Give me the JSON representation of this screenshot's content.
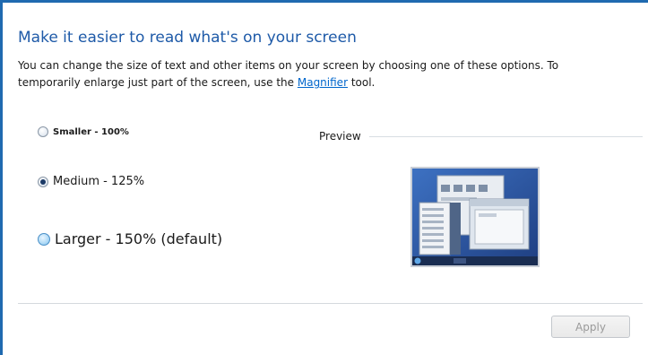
{
  "title": "Make it easier to read what's on your screen",
  "description": {
    "line1": "You can change the size of text and other items on your screen by choosing one of these options. To",
    "line2_prefix": "temporarily enlarge just part of the screen, use the ",
    "link": "Magnifier",
    "line2_suffix": " tool."
  },
  "options": [
    {
      "label": "Smaller - 100%",
      "selected": false
    },
    {
      "label": "Medium - 125%",
      "selected": true
    },
    {
      "label": "Larger - 150% (default)",
      "selected": false
    }
  ],
  "preview": {
    "label": "Preview"
  },
  "apply_label": "Apply",
  "colors": {
    "title": "#1e5aa8",
    "link": "#0066cc",
    "border": "#1f6ab0"
  }
}
